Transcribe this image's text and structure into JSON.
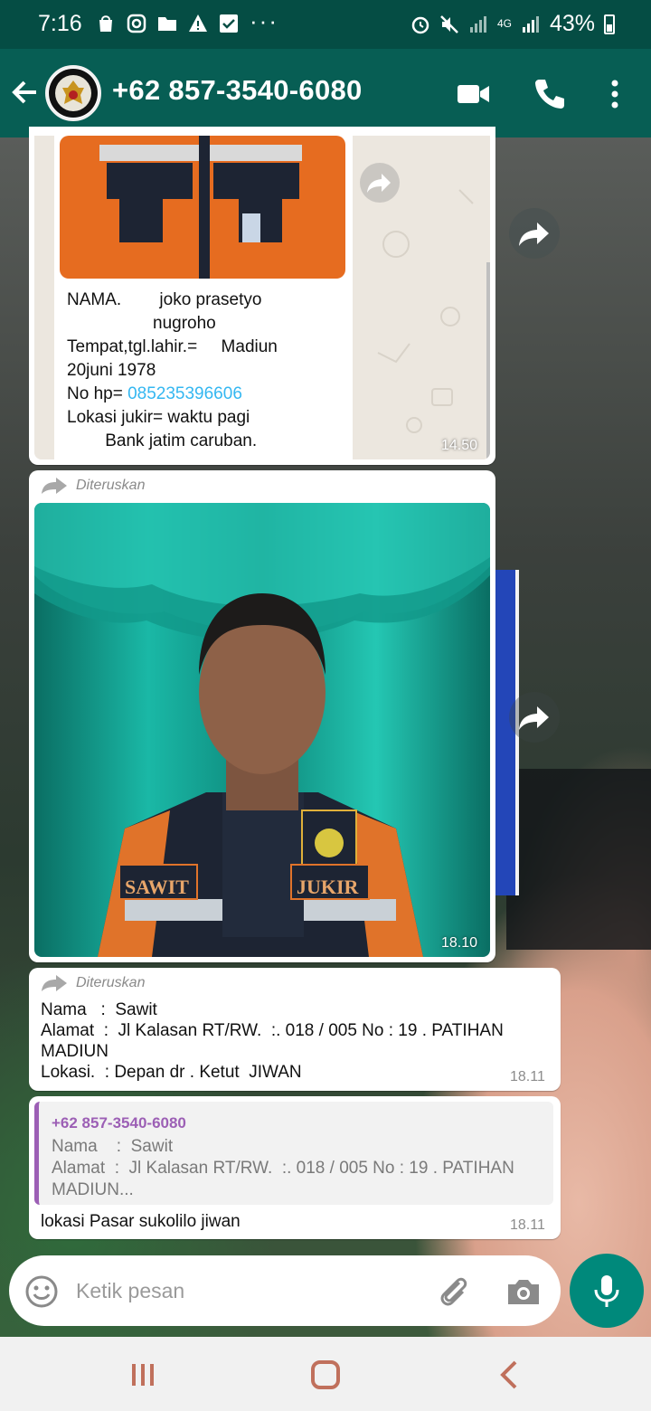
{
  "status_bar": {
    "time": "7:16",
    "dots": "···",
    "battery": "43%",
    "network": "4G"
  },
  "header": {
    "contact": "+62 857-3540-6080",
    "icons": [
      "back-arrow-icon",
      "video-call-icon",
      "phone-icon",
      "more-vert-icon"
    ]
  },
  "messages": [
    {
      "type": "image_with_caption",
      "lines": [
        "NAMA.        joko prasetyo",
        "                  nugroho",
        "Tempat,tgl.lahir.=     Madiun",
        "20juni 1978",
        "No hp= ",
        "Lokasi jukir= waktu pagi",
        "        Bank jatim caruban."
      ],
      "phone": "085235396606",
      "time": "14.50"
    },
    {
      "type": "image",
      "forwarded_label": "Diteruskan",
      "badge_left": "SAWIT",
      "badge_right": "JUKIR",
      "time": "18.10"
    },
    {
      "type": "text",
      "forwarded_label": "Diteruskan",
      "lines": [
        "Nama   :  Sawit",
        "Alamat  :  Jl Kalasan RT/RW.  :. 018 / 005 No : 19 . PATIHAN",
        "MADIUN",
        "Lokasi.  : Depan dr . Ketut  JIWAN"
      ],
      "time": "18.11"
    },
    {
      "type": "reply",
      "quoted_sender": "+62 857-3540-6080",
      "quoted_lines": [
        "Nama    :  Sawit",
        "Alamat  :  Jl Kalasan RT/RW.  :. 018 / 005 No : 19 . PATIHAN",
        "MADIUN..."
      ],
      "text": "lokasi Pasar sukolilo jiwan",
      "time": "18.11"
    }
  ],
  "compose": {
    "placeholder": "Ketik pesan"
  },
  "colors": {
    "header": "#075e54",
    "status_bar": "#054d44",
    "accent": "#00897b",
    "link": "#34b7f1",
    "quote_bar": "#9c5fb5"
  }
}
